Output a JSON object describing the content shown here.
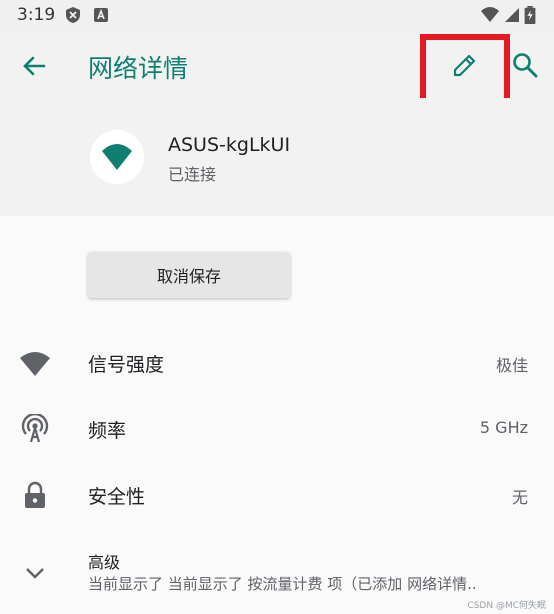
{
  "status_bar": {
    "time": "3:19",
    "left_icons": [
      "shield-icon",
      "a-box-icon"
    ],
    "right_icons": [
      "wifi-icon",
      "signal-icon",
      "battery-icon"
    ]
  },
  "app_bar": {
    "title": "网络详情",
    "icons": [
      "back-arrow-icon",
      "edit-pencil-icon",
      "search-icon"
    ],
    "accent_color": "#0e7f71",
    "highlight_color": "#e31b23"
  },
  "network": {
    "name": "ASUS-kgLkUI",
    "status": "已连接",
    "icon": "wifi-icon"
  },
  "actions": {
    "forget_label": "取消保存"
  },
  "details": [
    {
      "label": "信号强度",
      "value": "极佳",
      "icon": "wifi-signal-icon"
    },
    {
      "label": "频率",
      "value": "5 GHz",
      "icon": "antenna-icon"
    },
    {
      "label": "安全性",
      "value": "无",
      "icon": "lock-icon"
    }
  ],
  "advanced": {
    "title": "高级",
    "summary": "当前显示了 当前显示了 按流量计费 项（已添加 网络详情..",
    "icon": "chevron-down-icon"
  },
  "watermark": "CSDN @MC何失眠"
}
